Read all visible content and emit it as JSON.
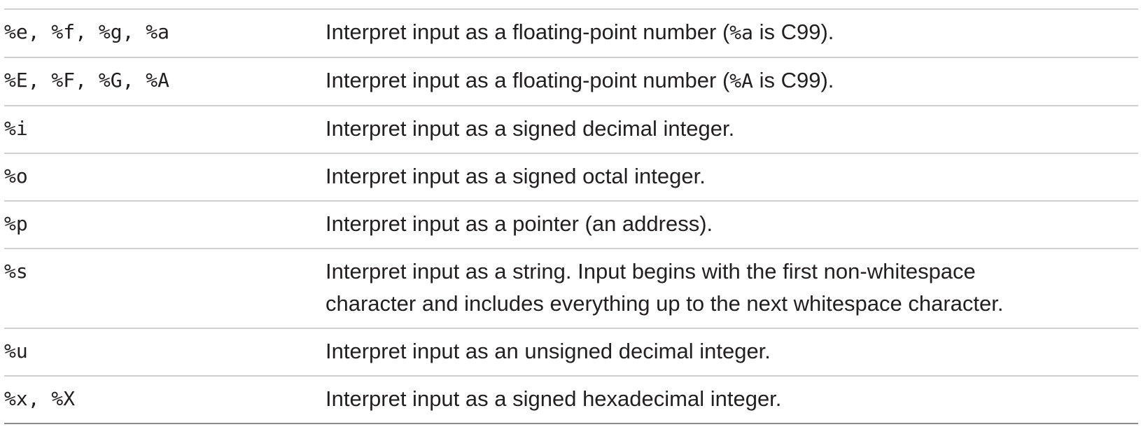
{
  "rows": [
    {
      "spec": "%e, %f, %g, %a",
      "desc_before": "Interpret input as a floating-point number (",
      "desc_code": "%a",
      "desc_after": " is C99)."
    },
    {
      "spec": "%E, %F, %G, %A",
      "desc_before": "Interpret input as a floating-point number (",
      "desc_code": "%A",
      "desc_after": " is C99)."
    },
    {
      "spec": "%i",
      "desc": "Interpret input as a signed decimal integer."
    },
    {
      "spec": "%o",
      "desc": "Interpret input as a signed octal integer."
    },
    {
      "spec": "%p",
      "desc": "Interpret input as a pointer (an address)."
    },
    {
      "spec": "%s",
      "desc_line1": "Interpret input as a string. Input begins with the first non-whitespace",
      "desc_line2": "character and includes everything up to the next whitespace character."
    },
    {
      "spec": "%u",
      "desc": "Interpret input as an unsigned decimal integer."
    },
    {
      "spec": "%x, %X",
      "desc": "Interpret input as a signed hexadecimal integer."
    }
  ]
}
